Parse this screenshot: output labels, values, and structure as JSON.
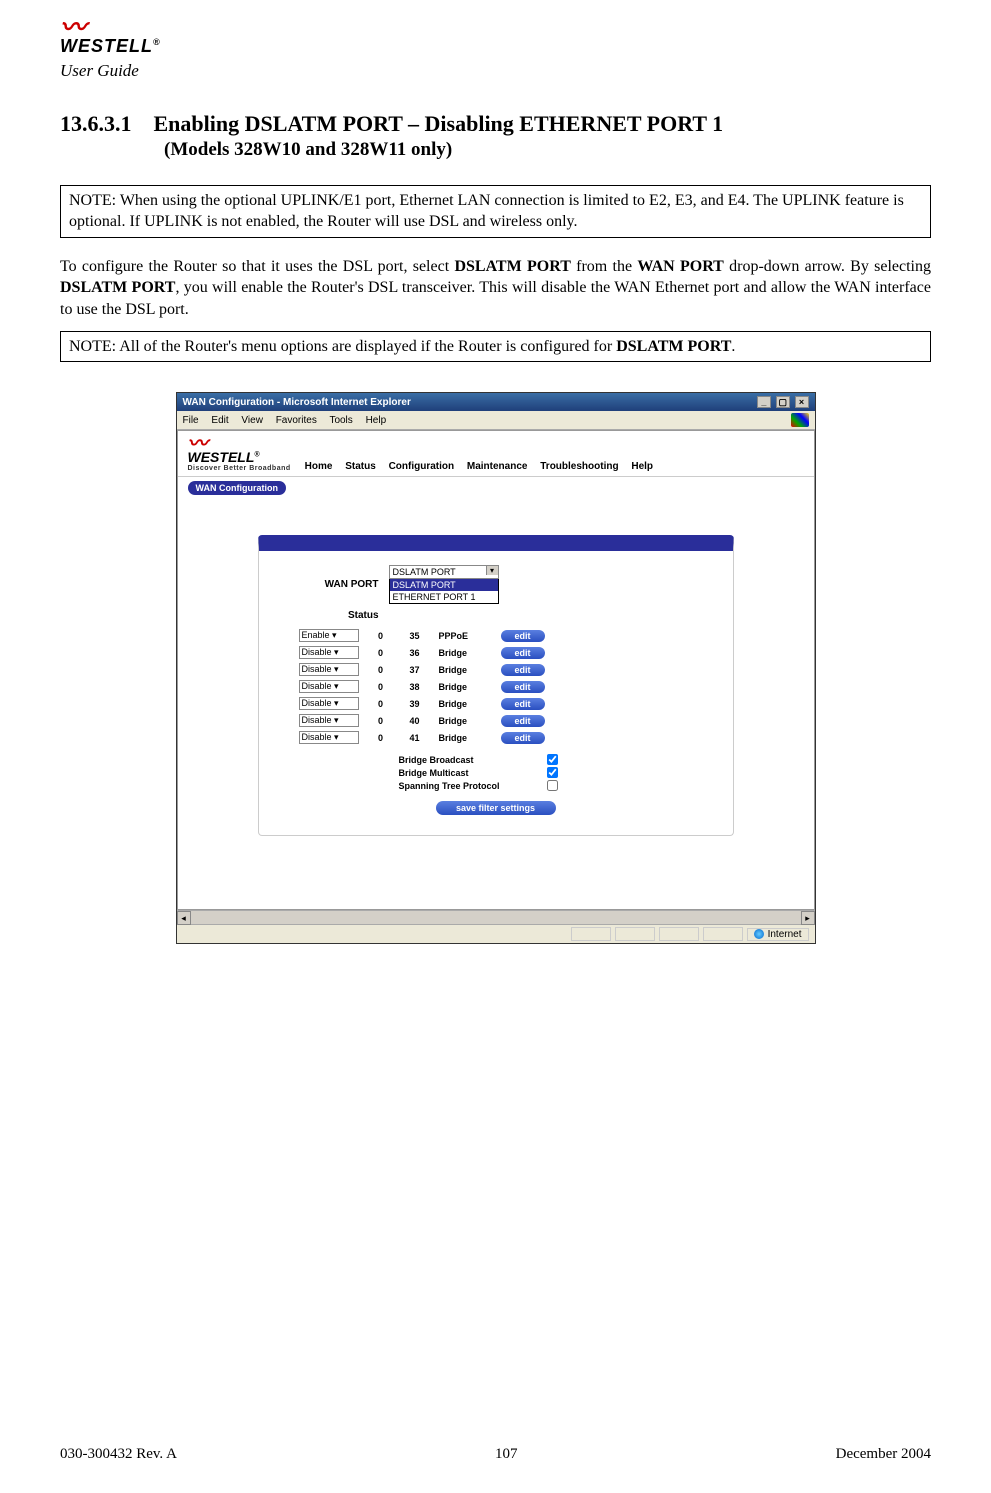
{
  "doc": {
    "brand": "WESTELL",
    "user_guide": "User Guide",
    "section_number": "13.6.3.1",
    "section_title": "Enabling DSLATM PORT – Disabling ETHERNET PORT 1",
    "section_subtitle": "(Models 328W10 and 328W11 only)",
    "note1": "NOTE: When using the optional UPLINK/E1 port, Ethernet LAN connection is limited to E2, E3, and E4. The UPLINK feature is optional. If UPLINK is not enabled, the Router will use DSL and wireless only.",
    "para1_a": "To configure the Router so that it uses the DSL port, select ",
    "para1_b": "DSLATM PORT",
    "para1_c": " from the ",
    "para1_d": "WAN PORT",
    "para1_e": " drop-down arrow. By selecting ",
    "para1_f": "DSLATM PORT",
    "para1_g": ", you will enable the Router's DSL transceiver. This will disable the WAN Ethernet port and allow the WAN interface to use the DSL port.",
    "note2_a": "NOTE: All of the Router's menu options are displayed if the Router is configured for ",
    "note2_b": "DSLATM PORT",
    "note2_c": ".",
    "footer_left": "030-300432 Rev. A",
    "footer_center": "107",
    "footer_right": "December 2004"
  },
  "screenshot": {
    "window_title": "WAN Configuration - Microsoft Internet Explorer",
    "menus": [
      "File",
      "Edit",
      "View",
      "Favorites",
      "Tools",
      "Help"
    ],
    "brand": "WESTELL",
    "brand_tag": "Discover Better Broadband",
    "nav": [
      "Home",
      "Status",
      "Configuration",
      "Maintenance",
      "Troubleshooting",
      "Help"
    ],
    "subtab": "WAN Configuration",
    "labels": {
      "wan_port": "WAN PORT",
      "status": "Status"
    },
    "wan_port_selected": "DSLATM PORT",
    "wan_port_options": [
      "DSLATM PORT",
      "ETHERNET PORT 1"
    ],
    "rows": [
      {
        "enable": "Enable",
        "vpi": "0",
        "vci": "35",
        "proto": "PPPoE",
        "btn": "edit"
      },
      {
        "enable": "Disable",
        "vpi": "0",
        "vci": "36",
        "proto": "Bridge",
        "btn": "edit"
      },
      {
        "enable": "Disable",
        "vpi": "0",
        "vci": "37",
        "proto": "Bridge",
        "btn": "edit"
      },
      {
        "enable": "Disable",
        "vpi": "0",
        "vci": "38",
        "proto": "Bridge",
        "btn": "edit"
      },
      {
        "enable": "Disable",
        "vpi": "0",
        "vci": "39",
        "proto": "Bridge",
        "btn": "edit"
      },
      {
        "enable": "Disable",
        "vpi": "0",
        "vci": "40",
        "proto": "Bridge",
        "btn": "edit"
      },
      {
        "enable": "Disable",
        "vpi": "0",
        "vci": "41",
        "proto": "Bridge",
        "btn": "edit"
      }
    ],
    "options": {
      "bridge_broadcast": {
        "label": "Bridge Broadcast",
        "checked": true
      },
      "bridge_multicast": {
        "label": "Bridge Multicast",
        "checked": true
      },
      "spanning_tree": {
        "label": "Spanning Tree Protocol",
        "checked": false
      }
    },
    "save_btn": "save filter settings",
    "status_zone": "Internet"
  }
}
